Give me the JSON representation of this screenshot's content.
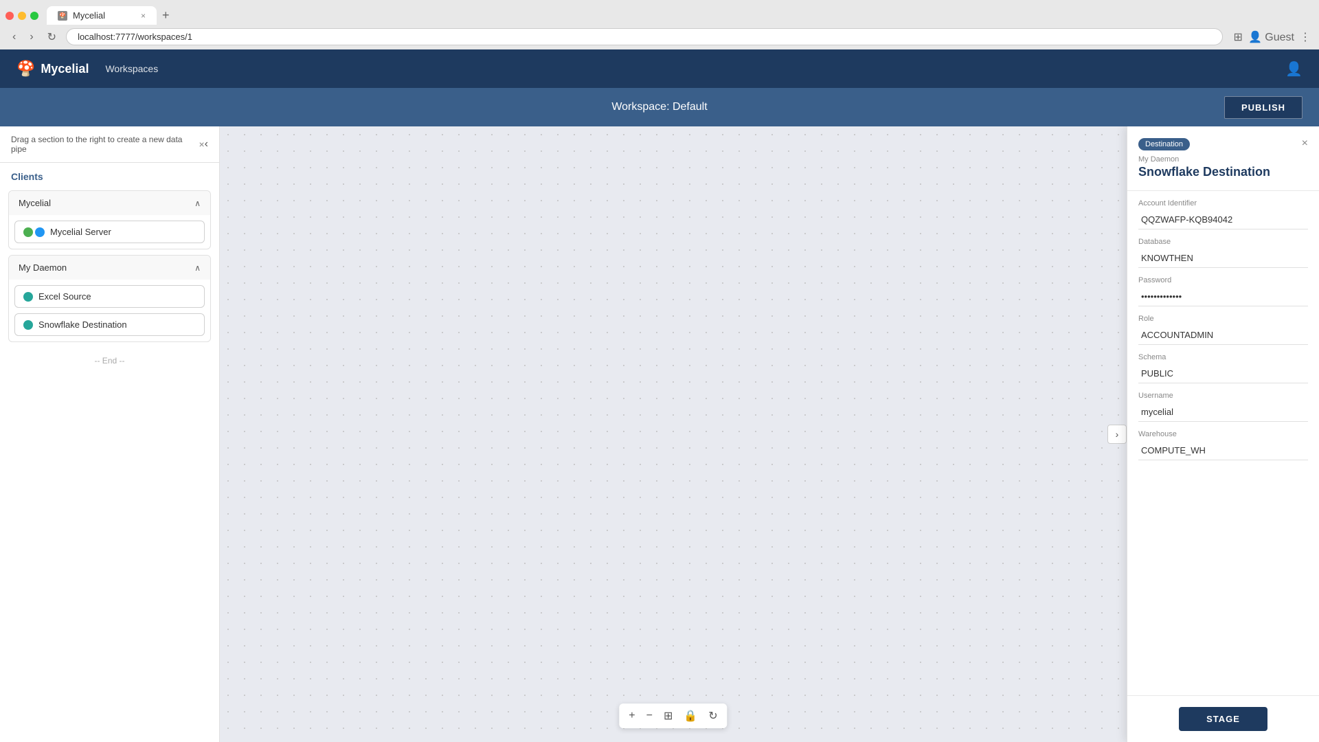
{
  "browser": {
    "url": "localhost:7777/workspaces/1",
    "tab_title": "Mycelial",
    "new_tab_icon": "+"
  },
  "nav": {
    "logo_icon": "🍄",
    "logo_text": "Mycelial",
    "workspaces_link": "Workspaces",
    "user_icon": "👤"
  },
  "workspace_bar": {
    "title": "Workspace: Default",
    "publish_label": "PUBLISH"
  },
  "sidebar": {
    "drag_hint": "Drag a section to the right to create a new data pipe",
    "clients_label": "Clients",
    "collapse_icon": "‹",
    "groups": [
      {
        "name": "Mycelial",
        "items": [
          {
            "label": "Mycelial Server",
            "indicators": [
              "green",
              "blue"
            ]
          }
        ]
      },
      {
        "name": "My Daemon",
        "items": [
          {
            "label": "Excel Source",
            "indicators": [
              "teal"
            ]
          },
          {
            "label": "Snowflake Destination",
            "indicators": [
              "teal"
            ]
          }
        ]
      }
    ],
    "end_label": "-- End --"
  },
  "canvas": {
    "toggle_right_icon": "›",
    "controls": [
      "+",
      "−",
      "⊞",
      "🔒",
      "↻"
    ]
  },
  "right_panel": {
    "badge": "Destination",
    "subtitle": "My Daemon",
    "title": "Snowflake Destination",
    "close_icon": "×",
    "fields": [
      {
        "label": "Account Identifier",
        "value": "QQZWAFP-KQB94042",
        "type": "text"
      },
      {
        "label": "Database",
        "value": "KNOWTHEN",
        "type": "text"
      },
      {
        "label": "Password",
        "value": "••••••••••••",
        "type": "password"
      },
      {
        "label": "Role",
        "value": "ACCOUNTADMIN",
        "type": "text"
      },
      {
        "label": "Schema",
        "value": "PUBLIC",
        "type": "text"
      },
      {
        "label": "Username",
        "value": "mycelial",
        "type": "text"
      },
      {
        "label": "Warehouse",
        "value": "COMPUTE_WH",
        "type": "text"
      }
    ],
    "stage_label": "STAGE"
  }
}
